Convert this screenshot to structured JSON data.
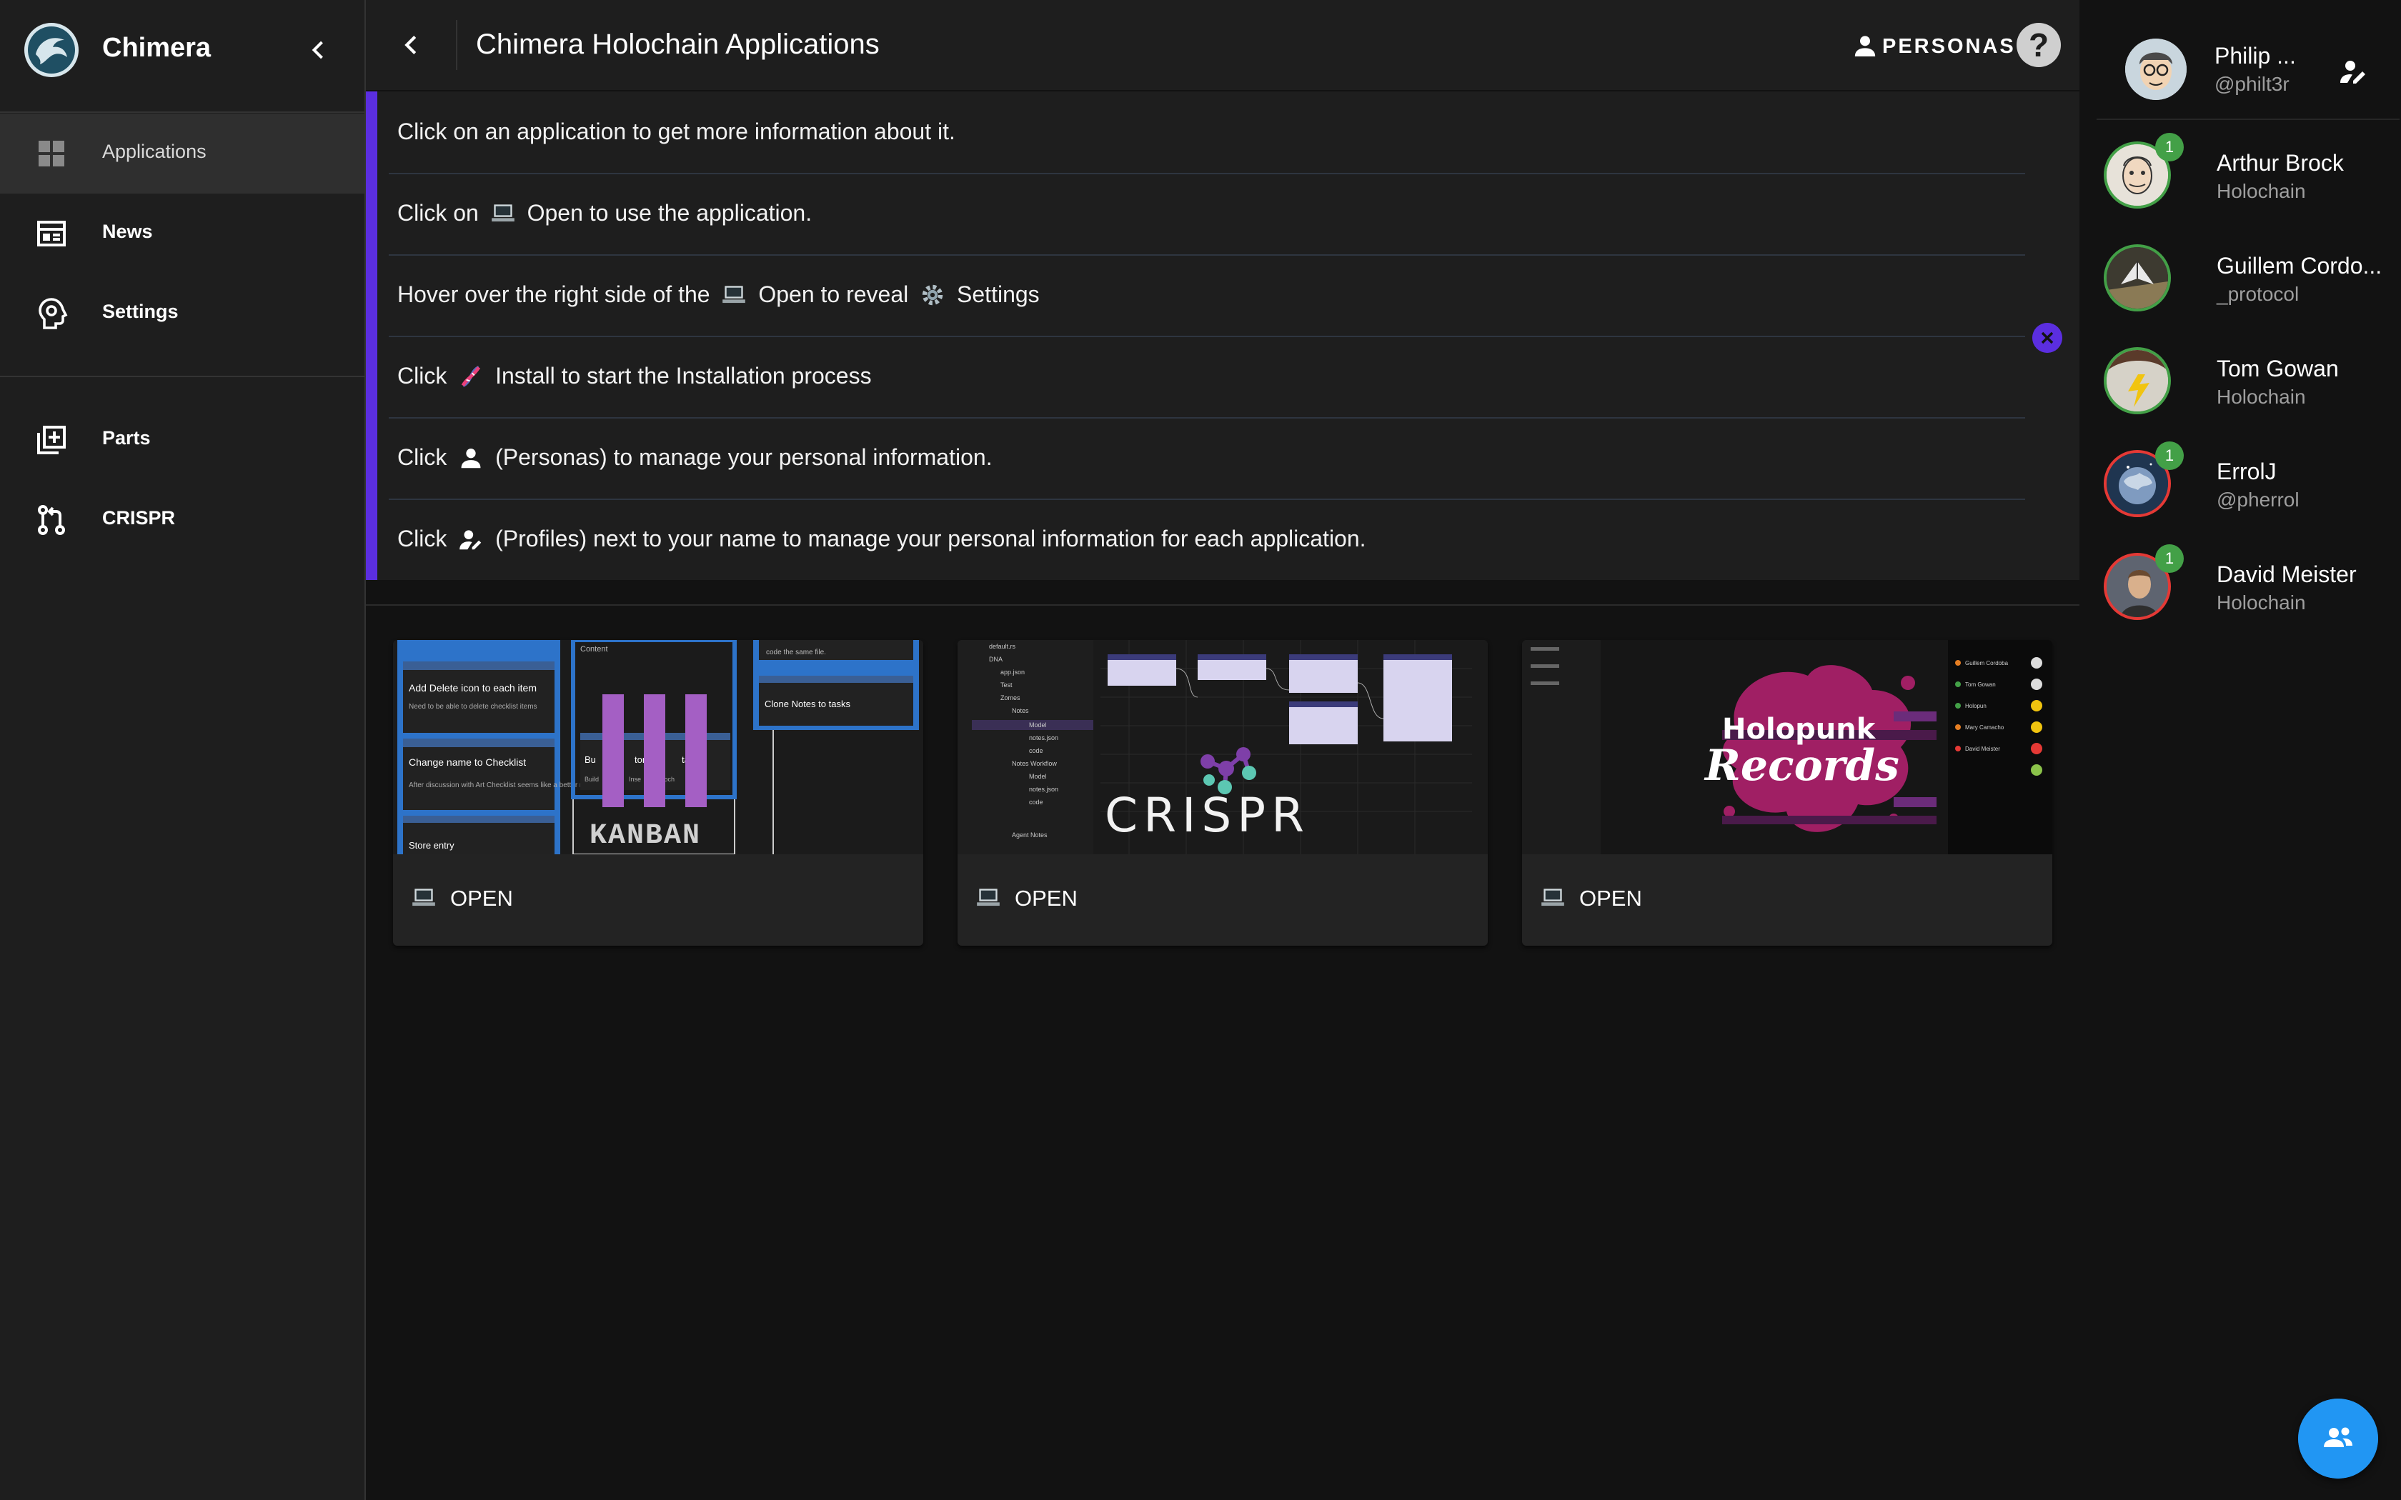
{
  "app": {
    "name": "Chimera"
  },
  "sidebar": {
    "items": [
      {
        "label": "Applications",
        "icon": "grid-icon"
      },
      {
        "label": "News",
        "icon": "news-icon"
      },
      {
        "label": "Settings",
        "icon": "settings-head-icon"
      },
      {
        "label": "Parts",
        "icon": "library-add-icon"
      },
      {
        "label": "CRISPR",
        "icon": "merge-icon"
      }
    ]
  },
  "header": {
    "title": "Chimera Holochain Applications",
    "personas_label": "PERSONAS",
    "help_label": "?"
  },
  "tips": [
    {
      "parts": [
        "Click on an application to get more information about it."
      ]
    },
    {
      "parts": [
        "Click on",
        "Open to use the application."
      ]
    },
    {
      "parts": [
        "Hover over the right side of the",
        "Open to reveal",
        "Settings"
      ]
    },
    {
      "parts": [
        "Click",
        "Install to start the Installation process"
      ]
    },
    {
      "parts": [
        "Click",
        "(Personas) to manage your personal information."
      ]
    },
    {
      "parts": [
        "Click",
        "(Profiles) next to your name to manage your personal information for each application."
      ]
    }
  ],
  "apps": [
    {
      "name": "kanban",
      "open_label": "OPEN",
      "preview": {
        "logo_text": "KANBAN",
        "cards": [
          "Add Delete icon to each item",
          "Need to be able to delete checklist items",
          "Change name to Checklist",
          "After discussion with Art Checklist seems like a better name for this part.",
          "Store entry",
          "Content",
          "Bu",
          "tomi",
          "task",
          "Build",
          "Inse",
          "Holoch",
          "code the same file.",
          "Clone Notes to tasks"
        ]
      }
    },
    {
      "name": "crispr",
      "open_label": "OPEN",
      "preview": {
        "logo_text": "CRISPR",
        "tree": [
          "default.rs",
          "DNA",
          "app.json",
          "Test",
          "Zomes",
          "Notes",
          "Model",
          "notes.json",
          "code",
          "Notes Workflow",
          "Model",
          "notes.json",
          "code",
          "Agent Notes"
        ]
      }
    },
    {
      "name": "holopunk",
      "open_label": "OPEN",
      "preview": {
        "logo_line1": "Holopunk",
        "logo_line2": "Records",
        "side_names": [
          "Guillem Cordoba",
          "Tom Gowan",
          "Holopun",
          "Mary Camacho",
          "David Meister"
        ]
      }
    }
  ],
  "current_user": {
    "name": "Philip ...",
    "handle": "@philt3r"
  },
  "users": [
    {
      "name": "Arthur Brock",
      "subtitle": "Holochain",
      "badge": "1",
      "ring": "#43a047"
    },
    {
      "name": "Guillem Cordo...",
      "subtitle": "_protocol",
      "badge": "",
      "ring": "#43a047"
    },
    {
      "name": "Tom Gowan",
      "subtitle": "Holochain",
      "badge": "",
      "ring": "#43a047"
    },
    {
      "name": "ErrolJ",
      "subtitle": "@pherrol",
      "badge": "1",
      "ring": "#e53935"
    },
    {
      "name": "David Meister",
      "subtitle": "Holochain",
      "badge": "1",
      "ring": "#e53935"
    }
  ],
  "colors": {
    "accent": "#5b2ee0",
    "fab": "#2196f3",
    "online": "#43a047",
    "offline": "#e53935"
  }
}
